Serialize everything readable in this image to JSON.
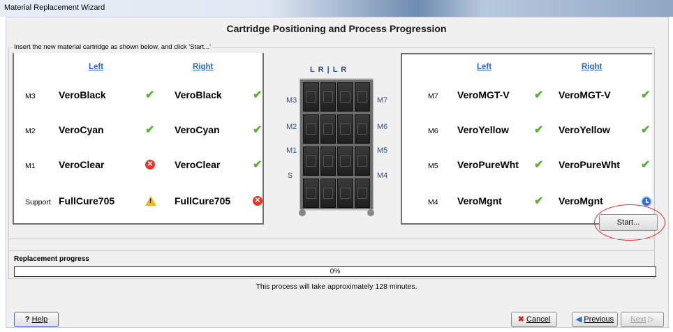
{
  "window": {
    "title": "Material Replacement Wizard"
  },
  "heading": "Cartridge Positioning and Process Progression",
  "instruction": "Insert the new material cartridge as shown below, and click 'Start...'",
  "left_panel": {
    "col_left": "Left",
    "col_right": "Right",
    "rows": [
      {
        "slot": "M3",
        "left": "VeroBlack",
        "left_status": "ok",
        "right": "VeroBlack",
        "right_status": "ok"
      },
      {
        "slot": "M2",
        "left": "VeroCyan",
        "left_status": "ok",
        "right": "VeroCyan",
        "right_status": "ok"
      },
      {
        "slot": "M1",
        "left": "VeroClear",
        "left_status": "error",
        "right": "VeroClear",
        "right_status": "ok"
      },
      {
        "slot": "Support",
        "left": "FullCure705",
        "left_status": "warning",
        "right": "FullCure705",
        "right_status": "error"
      }
    ]
  },
  "right_panel": {
    "col_left": "Left",
    "col_right": "Right",
    "rows": [
      {
        "slot": "M7",
        "left": "VeroMGT-V",
        "left_status": "ok",
        "right": "VeroMGT-V",
        "right_status": "ok"
      },
      {
        "slot": "M6",
        "left": "VeroYellow",
        "left_status": "ok",
        "right": "VeroYellow",
        "right_status": "ok"
      },
      {
        "slot": "M5",
        "left": "VeroPureWht",
        "left_status": "ok",
        "right": "VeroPureWht",
        "right_status": "ok"
      },
      {
        "slot": "M4",
        "left": "VeroMgnt",
        "left_status": "ok",
        "right": "VeroMgnt",
        "right_status": "pending"
      }
    ]
  },
  "cabinet": {
    "top_labels": "L  R | L  R",
    "left_labels": [
      "M3",
      "M2",
      "M1",
      "S"
    ],
    "right_labels": [
      "M7",
      "M6",
      "M5",
      "M4"
    ]
  },
  "start_button": "Start...",
  "progress": {
    "title": "Replacement progress",
    "value_text": "0%",
    "message": "This process will take approximately 128 minutes."
  },
  "buttons": {
    "help": "Help",
    "cancel": "Cancel",
    "previous": "Previous",
    "next": "Next"
  },
  "colors": {
    "link_blue": "#2a68c4",
    "check_green": "#5cb135",
    "error_red": "#e03a2c",
    "warning_yellow": "#f2b90f"
  }
}
